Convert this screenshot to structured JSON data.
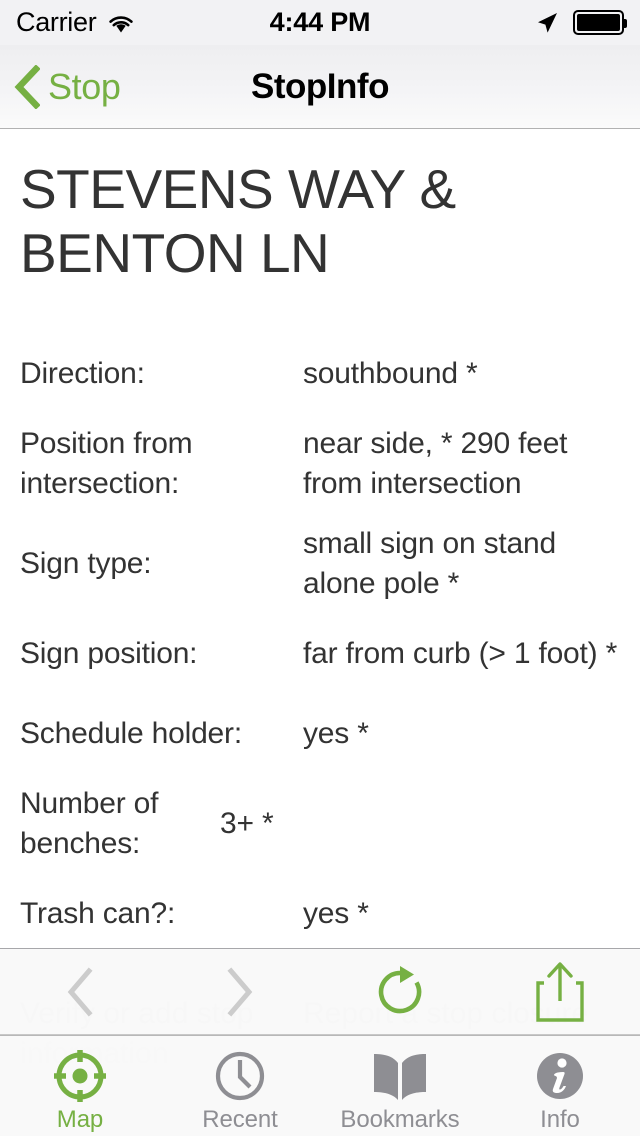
{
  "status_bar": {
    "carrier": "Carrier",
    "time": "4:44 PM",
    "wifi_icon": "wifi-icon",
    "location_icon": "location-arrow-icon",
    "battery_icon": "battery-full-icon"
  },
  "nav_bar": {
    "back_label": "Stop",
    "back_icon": "chevron-left-icon",
    "title": "StopInfo"
  },
  "stop": {
    "name": "STEVENS WAY & BENTON LN",
    "details": [
      {
        "label": "Direction:",
        "value": "southbound *"
      },
      {
        "label": "Position from intersection:",
        "value": "near side, * 290 feet from intersection"
      },
      {
        "label": "Sign type:",
        "value": "small sign on stand alone pole *"
      },
      {
        "label": "Sign position:",
        "value": "far from curb (> 1 foot) *"
      },
      {
        "label": "Schedule holder:",
        "value": "yes *"
      },
      {
        "label": "Number of benches:",
        "value": "3+ *"
      },
      {
        "label": "Trash can?:",
        "value": "yes *"
      }
    ],
    "obscured": [
      {
        "label": "Verify or add stop information",
        "value": "Report a stop closure"
      }
    ]
  },
  "toolbar": {
    "back_icon": "chevron-left-icon",
    "forward_icon": "chevron-right-icon",
    "reload_icon": "reload-icon",
    "share_icon": "share-icon"
  },
  "tab_bar": {
    "items": [
      {
        "label": "Map",
        "icon": "crosshair-target-icon",
        "active": true
      },
      {
        "label": "Recent",
        "icon": "clock-icon",
        "active": false
      },
      {
        "label": "Bookmarks",
        "icon": "book-open-icon",
        "active": false
      },
      {
        "label": "Info",
        "icon": "info-circle-icon",
        "active": false
      }
    ]
  },
  "colors": {
    "accent_green": "#76b043",
    "text_primary": "#333333",
    "tab_inactive": "#8e8e93",
    "toolbar_disabled": "#cccccc"
  }
}
